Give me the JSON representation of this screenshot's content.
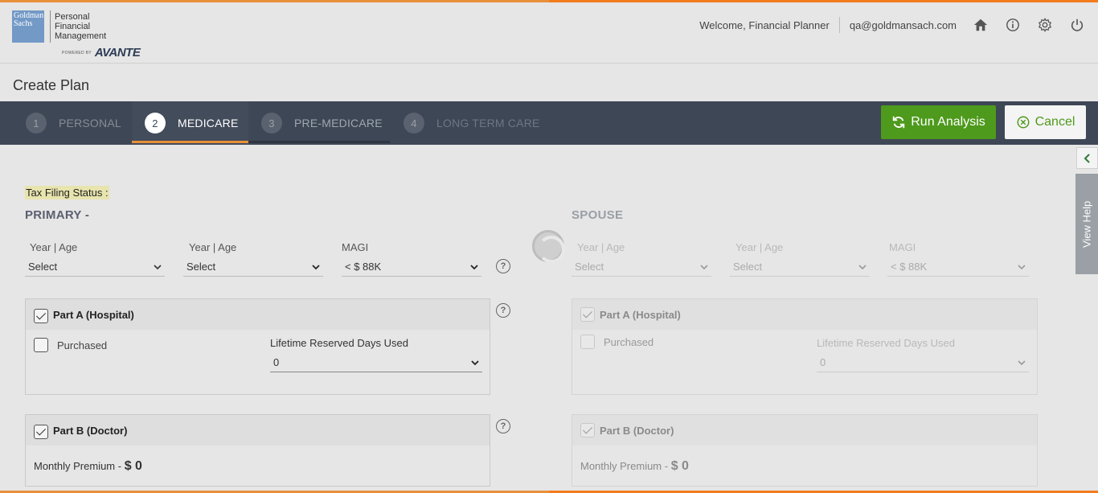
{
  "header": {
    "logo_text": "Goldman Sachs",
    "brand_lines": [
      "Personal",
      "Financial",
      "Management"
    ],
    "powered_by": "POWERED BY",
    "powered_brand": "AVANTE",
    "welcome": "Welcome, Financial Planner",
    "email": "qa@goldmansach.com",
    "icons": [
      "home-icon",
      "info-icon",
      "gear-icon",
      "power-icon"
    ]
  },
  "page": {
    "title": "Create Plan"
  },
  "steps": [
    {
      "num": "1",
      "label": "PERSONAL"
    },
    {
      "num": "2",
      "label": "MEDICARE"
    },
    {
      "num": "3",
      "label": "PRE-MEDICARE"
    },
    {
      "num": "4",
      "label": "LONG TERM CARE"
    }
  ],
  "actions": {
    "run": "Run Analysis",
    "cancel": "Cancel"
  },
  "tax_filing_label": "Tax Filing Status :",
  "primary": {
    "heading": "PRIMARY -",
    "year_age_label_1": "Year  |  Age",
    "year_age_value_1": "Select",
    "year_age_label_2": "Year  |  Age",
    "year_age_value_2": "Select",
    "magi_label": "MAGI",
    "magi_value": "< $ 88K",
    "part_a": {
      "title": "Part A (Hospital)",
      "purchased": "Purchased",
      "lifetime_label": "Lifetime Reserved Days Used",
      "lifetime_value": "0"
    },
    "part_b": {
      "title": "Part B (Doctor)",
      "premium_label": "Monthly Premium - ",
      "premium_value": "$ 0"
    }
  },
  "spouse": {
    "heading": "SPOUSE",
    "year_age_label_1": "Year  |  Age",
    "year_age_value_1": "Select",
    "year_age_label_2": "Year  |  Age",
    "year_age_value_2": "Select",
    "magi_label": "MAGI",
    "magi_value": "< $ 88K",
    "part_a": {
      "title": "Part A (Hospital)",
      "purchased": "Purchased",
      "lifetime_label": "Lifetime Reserved Days Used",
      "lifetime_value": "0"
    },
    "part_b": {
      "title": "Part B (Doctor)",
      "premium_label": "Monthly Premium - ",
      "premium_value": "$ 0"
    }
  },
  "help_tab": "View Help",
  "colors": {
    "accent": "#f27c1e",
    "nav": "#3e4756",
    "run": "#4e9a1c"
  }
}
